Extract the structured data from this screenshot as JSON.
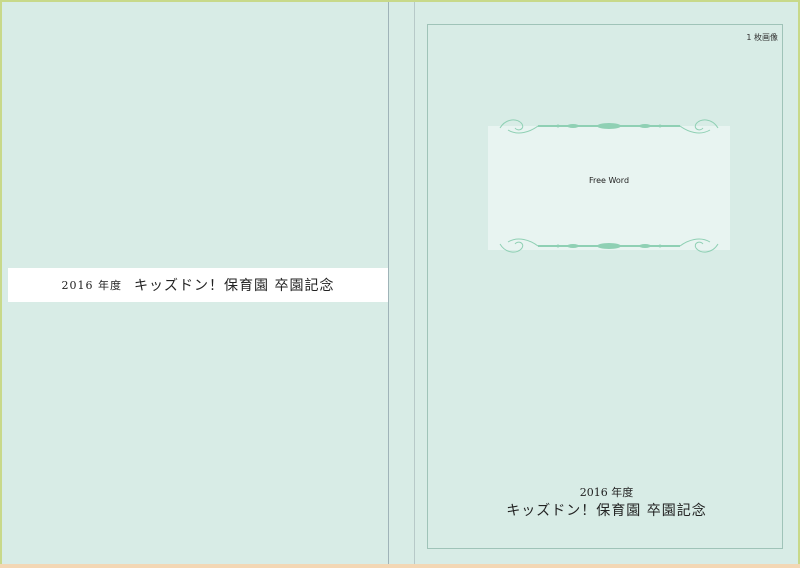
{
  "back_cover": {
    "year": "2016 年度",
    "title": "キッズドン！保育園 卒園記念"
  },
  "front_cover": {
    "badge": "1 枚画像",
    "photo_caption": "Free Word",
    "year": "2016 年度",
    "title": "キッズドン！保育園 卒園記念"
  },
  "colors": {
    "cover_background": "#d8ece6",
    "outer_border": "#c8d98a",
    "photo_background": "#e8f4f1",
    "ornament": "#8fd0b4"
  }
}
